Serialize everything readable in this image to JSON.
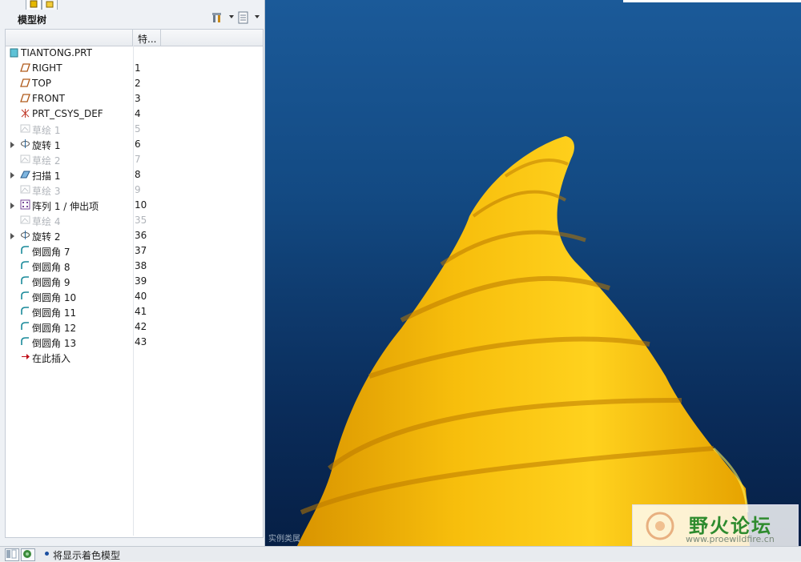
{
  "panel": {
    "title": "模型树",
    "column_header": "特..."
  },
  "tree": {
    "items": [
      {
        "label": "TIANTONG.PRT",
        "num": "",
        "icon": "part-icon",
        "expandable": false,
        "dim": false
      },
      {
        "label": "RIGHT",
        "num": "1",
        "icon": "datum-plane-icon",
        "expandable": false,
        "dim": false
      },
      {
        "label": "TOP",
        "num": "2",
        "icon": "datum-plane-icon",
        "expandable": false,
        "dim": false
      },
      {
        "label": "FRONT",
        "num": "3",
        "icon": "datum-plane-icon",
        "expandable": false,
        "dim": false
      },
      {
        "label": "PRT_CSYS_DEF",
        "num": "4",
        "icon": "csys-icon",
        "expandable": false,
        "dim": false
      },
      {
        "label": "草绘 1",
        "num": "5",
        "icon": "sketch-icon",
        "expandable": false,
        "dim": true
      },
      {
        "label": "旋转 1",
        "num": "6",
        "icon": "revolve-icon",
        "expandable": true,
        "dim": false
      },
      {
        "label": "草绘 2",
        "num": "7",
        "icon": "sketch-icon",
        "expandable": false,
        "dim": true
      },
      {
        "label": "扫描 1",
        "num": "8",
        "icon": "sweep-icon",
        "expandable": true,
        "dim": false
      },
      {
        "label": "草绘 3",
        "num": "9",
        "icon": "sketch-icon",
        "expandable": false,
        "dim": true
      },
      {
        "label": "阵列 1 / 伸出项",
        "num": "10",
        "icon": "pattern-icon",
        "expandable": true,
        "dim": false
      },
      {
        "label": "草绘 4",
        "num": "35",
        "icon": "sketch-icon",
        "expandable": false,
        "dim": true
      },
      {
        "label": "旋转 2",
        "num": "36",
        "icon": "revolve-icon",
        "expandable": true,
        "dim": false
      },
      {
        "label": "倒圆角 7",
        "num": "37",
        "icon": "round-icon",
        "expandable": false,
        "dim": false
      },
      {
        "label": "倒圆角 8",
        "num": "38",
        "icon": "round-icon",
        "expandable": false,
        "dim": false
      },
      {
        "label": "倒圆角 9",
        "num": "39",
        "icon": "round-icon",
        "expandable": false,
        "dim": false
      },
      {
        "label": "倒圆角 10",
        "num": "40",
        "icon": "round-icon",
        "expandable": false,
        "dim": false
      },
      {
        "label": "倒圆角 11",
        "num": "41",
        "icon": "round-icon",
        "expandable": false,
        "dim": false
      },
      {
        "label": "倒圆角 12",
        "num": "42",
        "icon": "round-icon",
        "expandable": false,
        "dim": false
      },
      {
        "label": "倒圆角 13",
        "num": "43",
        "icon": "round-icon",
        "expandable": false,
        "dim": false
      },
      {
        "label": "在此插入",
        "num": "",
        "icon": "insert-here-arrow-icon",
        "expandable": false,
        "dim": false
      }
    ]
  },
  "viewport": {
    "corner_label": "实例类属",
    "background_top": "#1b5a99",
    "background_bottom": "#061f45",
    "model_color": "#f5b800"
  },
  "watermark": {
    "title": "野火论坛",
    "subtitle": "www.proewildfire.cn"
  },
  "statusbar": {
    "message": "将显示着色模型"
  }
}
